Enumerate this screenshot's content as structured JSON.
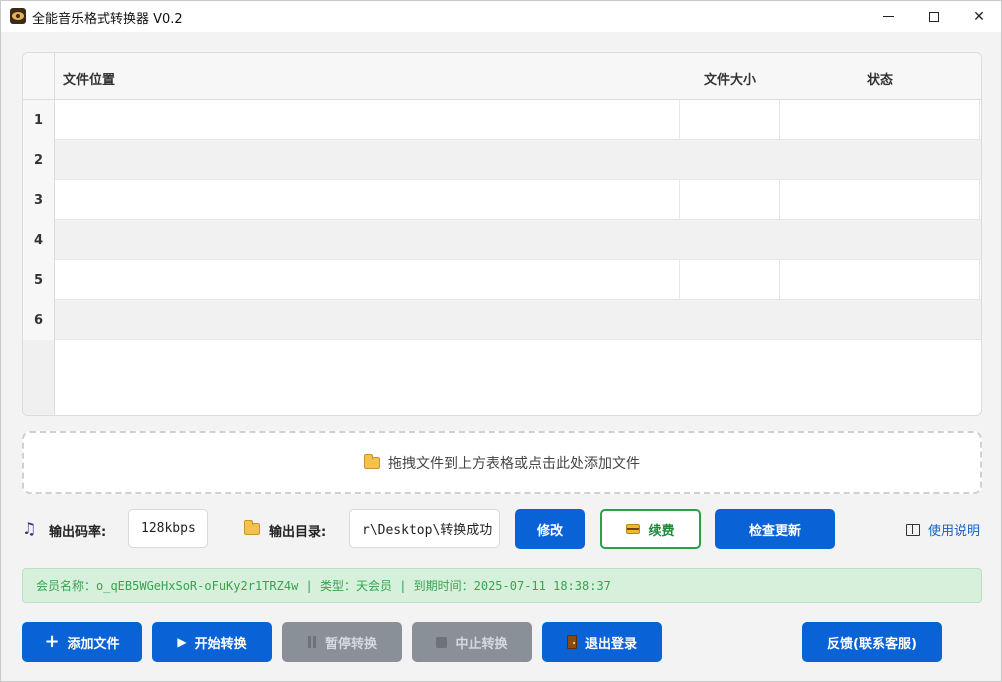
{
  "window": {
    "title": "全能音乐格式转换器 V0.2",
    "controls": {
      "minimize": "",
      "maximize": "",
      "close": "✕"
    }
  },
  "table": {
    "headers": {
      "location": "文件位置",
      "size": "文件大小",
      "status": "状态"
    },
    "rows": [
      {
        "num": "1",
        "location": "",
        "size": "",
        "status": ""
      },
      {
        "num": "2",
        "location": "",
        "size": "",
        "status": ""
      },
      {
        "num": "3",
        "location": "",
        "size": "",
        "status": ""
      },
      {
        "num": "4",
        "location": "",
        "size": "",
        "status": ""
      },
      {
        "num": "5",
        "location": "",
        "size": "",
        "status": ""
      },
      {
        "num": "6",
        "location": "",
        "size": "",
        "status": ""
      }
    ]
  },
  "dropzone": {
    "text": "拖拽文件到上方表格或点击此处添加文件",
    "icon": "folder-icon"
  },
  "settings": {
    "bitrate_label": "输出码率:",
    "bitrate_value": "128kbps",
    "outdir_label": "输出目录:",
    "outdir_value": "r\\Desktop\\转换成功",
    "modify_label": "修改",
    "renew_label": "续费",
    "check_update_label": "检查更新",
    "manual_label": "使用说明"
  },
  "member": {
    "text": "会员名称：o_qEB5WGeHxSoR-oFuKy2r1TRZ4w | 类型：天会员 | 到期时间：2025-07-11 18:38:37"
  },
  "actions": {
    "add_file": "添加文件",
    "start": "开始转换",
    "pause": "暂停转换",
    "stop": "中止转换",
    "logout": "退出登录",
    "feedback": "反馈(联系客服)"
  },
  "colors": {
    "primary": "#0a63d6",
    "disabled": "#8a9097",
    "success_border": "#2aa04a",
    "member_bg": "#d6f0dc",
    "member_text": "#3aa14f"
  }
}
